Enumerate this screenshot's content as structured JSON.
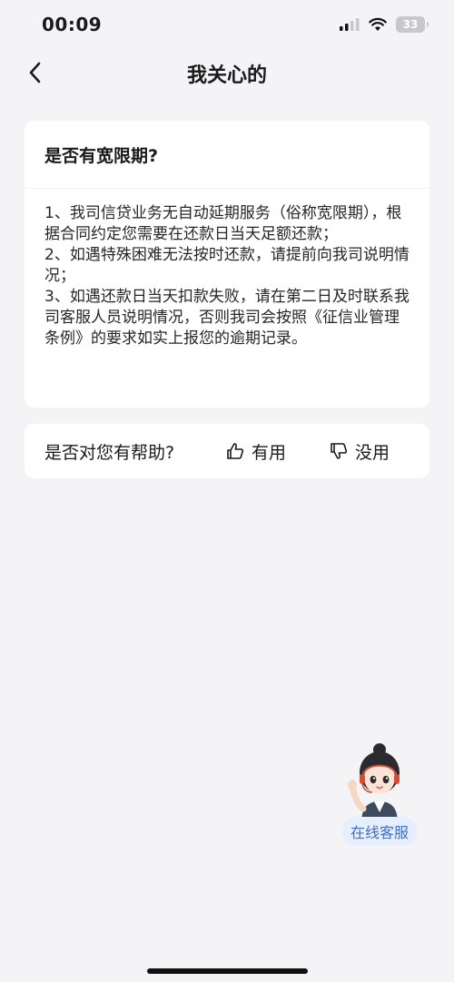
{
  "status_bar": {
    "time": "00:09",
    "battery": "33"
  },
  "nav": {
    "title": "我关心的"
  },
  "faq": {
    "question": "是否有宽限期?",
    "answer_lines": [
      "1、我司信贷业务无自动延期服务（俗称宽限期），根据合同约定您需要在还款日当天足额还款；",
      "2、如遇特殊困难无法按时还款，请提前向我司说明情况；",
      "3、如遇还款日当天扣款失败，请在第二日及时联系我司客服人员说明情况，否则我司会按照《征信业管理条例》的要求如实上报您的逾期记录。"
    ]
  },
  "feedback": {
    "question": "是否对您有帮助?",
    "useful_label": "有用",
    "useless_label": "没用"
  },
  "customer_service": {
    "label": "在线客服"
  },
  "colors": {
    "background": "#f4f4f6",
    "card": "#ffffff",
    "accent": "#3f6fc6"
  }
}
